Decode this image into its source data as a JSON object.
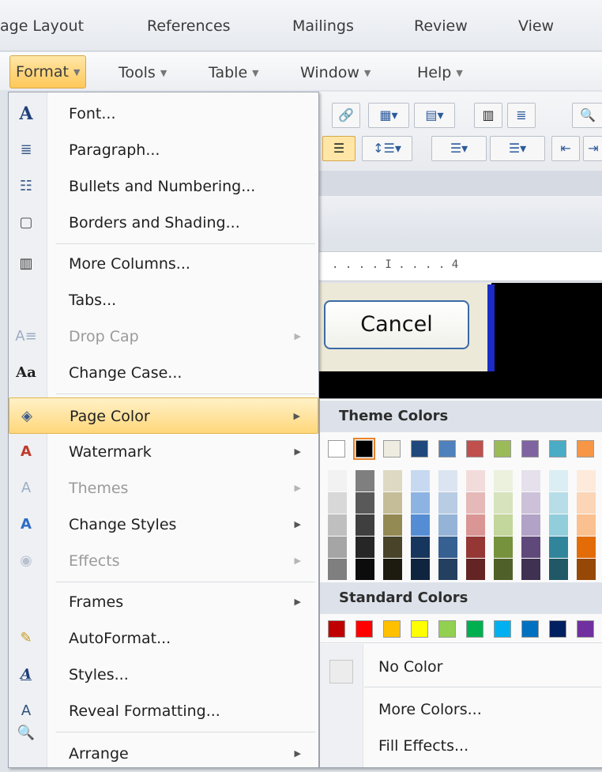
{
  "ribbon": {
    "tabs": [
      "age Layout",
      "References",
      "Mailings",
      "Review",
      "View"
    ]
  },
  "menubar": {
    "format": "Format",
    "tools": "Tools",
    "table": "Table",
    "window": "Window",
    "help": "Help"
  },
  "format_menu": {
    "items": [
      {
        "label": "Font...",
        "icon": "font-icon",
        "disabled": false,
        "submenu": false
      },
      {
        "label": "Paragraph...",
        "icon": "paragraph-icon",
        "disabled": false,
        "submenu": false
      },
      {
        "label": "Bullets and Numbering...",
        "icon": "bullets-icon",
        "disabled": false,
        "submenu": false
      },
      {
        "label": "Borders and Shading...",
        "icon": "borders-icon",
        "disabled": false,
        "submenu": false
      },
      {
        "label": "More Columns...",
        "icon": "columns-icon",
        "disabled": false,
        "submenu": false
      },
      {
        "label": "Tabs...",
        "icon": "",
        "disabled": false,
        "submenu": false
      },
      {
        "label": "Drop Cap",
        "icon": "drop-cap-icon",
        "disabled": true,
        "submenu": true
      },
      {
        "label": "Change Case...",
        "icon": "change-case-icon",
        "disabled": false,
        "submenu": false
      },
      {
        "label": "Page Color",
        "icon": "paint-bucket-icon",
        "disabled": false,
        "submenu": true,
        "highlighted": true
      },
      {
        "label": "Watermark",
        "icon": "watermark-icon",
        "disabled": false,
        "submenu": true
      },
      {
        "label": "Themes",
        "icon": "themes-icon",
        "disabled": true,
        "submenu": true
      },
      {
        "label": "Change Styles",
        "icon": "change-styles-icon",
        "disabled": false,
        "submenu": true
      },
      {
        "label": "Effects",
        "icon": "effects-icon",
        "disabled": true,
        "submenu": true
      },
      {
        "label": "Frames",
        "icon": "",
        "disabled": false,
        "submenu": true
      },
      {
        "label": "AutoFormat...",
        "icon": "autoformat-icon",
        "disabled": false,
        "submenu": false
      },
      {
        "label": "Styles...",
        "icon": "styles-icon",
        "disabled": false,
        "submenu": false
      },
      {
        "label": "Reveal Formatting...",
        "icon": "reveal-formatting-icon",
        "disabled": false,
        "submenu": false
      },
      {
        "label": "Arrange",
        "icon": "",
        "disabled": false,
        "submenu": true
      }
    ]
  },
  "page_color": {
    "theme_header": "Theme Colors",
    "standard_header": "Standard Colors",
    "theme_base": [
      "#ffffff",
      "#000000",
      "#eeece1",
      "#1f497d",
      "#4f81bd",
      "#c0504d",
      "#9bbb59",
      "#8064a2",
      "#4bacc6",
      "#f79646"
    ],
    "theme_shades": [
      [
        "#f2f2f2",
        "#d8d8d8",
        "#bfbfbf",
        "#a5a5a5",
        "#7f7f7f"
      ],
      [
        "#7f7f7f",
        "#595959",
        "#3f3f3f",
        "#262626",
        "#0c0c0c"
      ],
      [
        "#ddd9c3",
        "#c4bd97",
        "#938953",
        "#494429",
        "#1d1b10"
      ],
      [
        "#c6d9f0",
        "#8db3e2",
        "#548dd4",
        "#17365d",
        "#0f243e"
      ],
      [
        "#dbe5f1",
        "#b8cce4",
        "#95b3d7",
        "#366092",
        "#244061"
      ],
      [
        "#f2dcdb",
        "#e5b9b7",
        "#d99694",
        "#953734",
        "#632423"
      ],
      [
        "#ebf1dd",
        "#d7e3bc",
        "#c3d69b",
        "#76923c",
        "#4f6128"
      ],
      [
        "#e5e0ec",
        "#ccc1d9",
        "#b2a2c7",
        "#5f497a",
        "#3f3151"
      ],
      [
        "#dbeef3",
        "#b7dde8",
        "#92cddc",
        "#31859b",
        "#205867"
      ],
      [
        "#fdeada",
        "#fbd5b5",
        "#fac08f",
        "#e36c09",
        "#974806"
      ]
    ],
    "standard": [
      "#c00000",
      "#ff0000",
      "#ffc000",
      "#ffff00",
      "#92d050",
      "#00b050",
      "#00b0f0",
      "#0070c0",
      "#002060",
      "#7030a0"
    ],
    "no_color": "No Color",
    "more_colors": "More Colors...",
    "fill_effects": "Fill Effects..."
  },
  "background": {
    "cancel_label": "Cancel",
    "ruler_text": ". . . . I . . . . 4"
  }
}
